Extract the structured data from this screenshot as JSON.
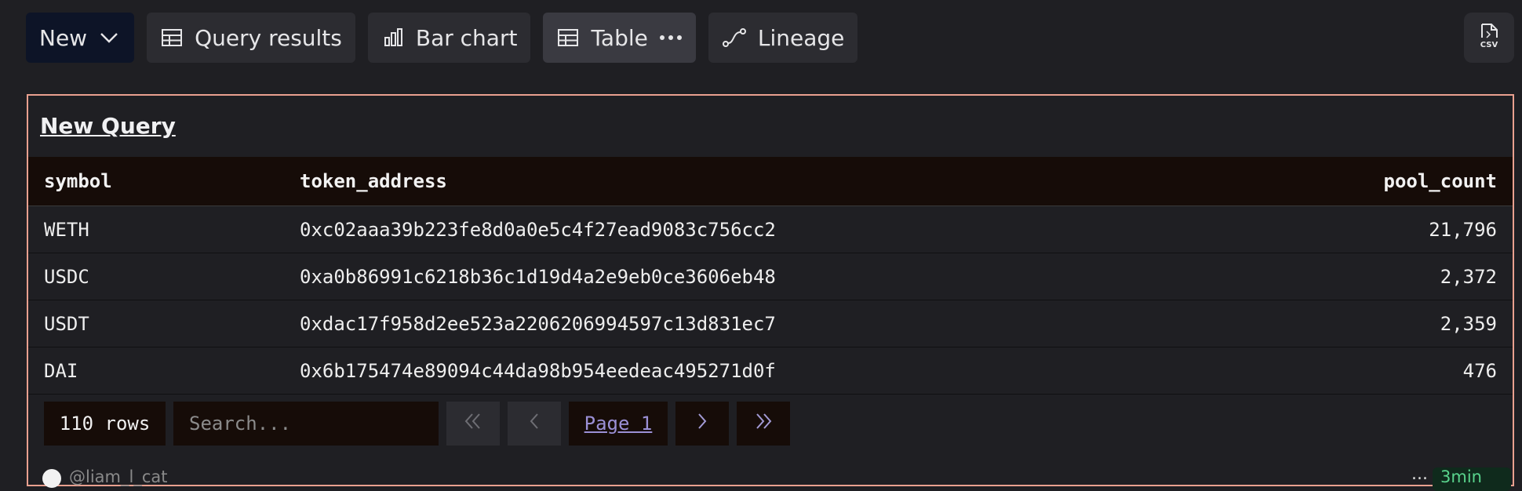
{
  "toolbar": {
    "new_label": "New",
    "tabs": [
      {
        "label": "Query results",
        "icon": "table-icon"
      },
      {
        "label": "Bar chart",
        "icon": "bar-chart-icon"
      },
      {
        "label": "Table",
        "icon": "table-icon",
        "active": true
      },
      {
        "label": "Lineage",
        "icon": "lineage-icon"
      }
    ],
    "csv_label": "CSV"
  },
  "query": {
    "title": "New Query",
    "columns": [
      "symbol",
      "token_address",
      "pool_count"
    ],
    "rows": [
      [
        "WETH",
        "0xc02aaa39b223fe8d0a0e5c4f27ead9083c756cc2",
        "21,796"
      ],
      [
        "USDC",
        "0xa0b86991c6218b36c1d19d4a2e9eb0ce3606eb48",
        "2,372"
      ],
      [
        "USDT",
        "0xdac17f958d2ee523a2206206994597c13d831ec7",
        "2,359"
      ],
      [
        "DAI",
        "0x6b175474e89094c44da98b954eedeac495271d0f",
        "476"
      ]
    ]
  },
  "pager": {
    "rows_label": "110 rows",
    "search_placeholder": "Search...",
    "page_label": "Page 1"
  },
  "footer": {
    "user": "@liam_l_cat",
    "more": "...",
    "time": "3min"
  },
  "colors": {
    "background": "#1f1f23",
    "accent": "#e9a08f",
    "new_button": "#0d1427"
  }
}
